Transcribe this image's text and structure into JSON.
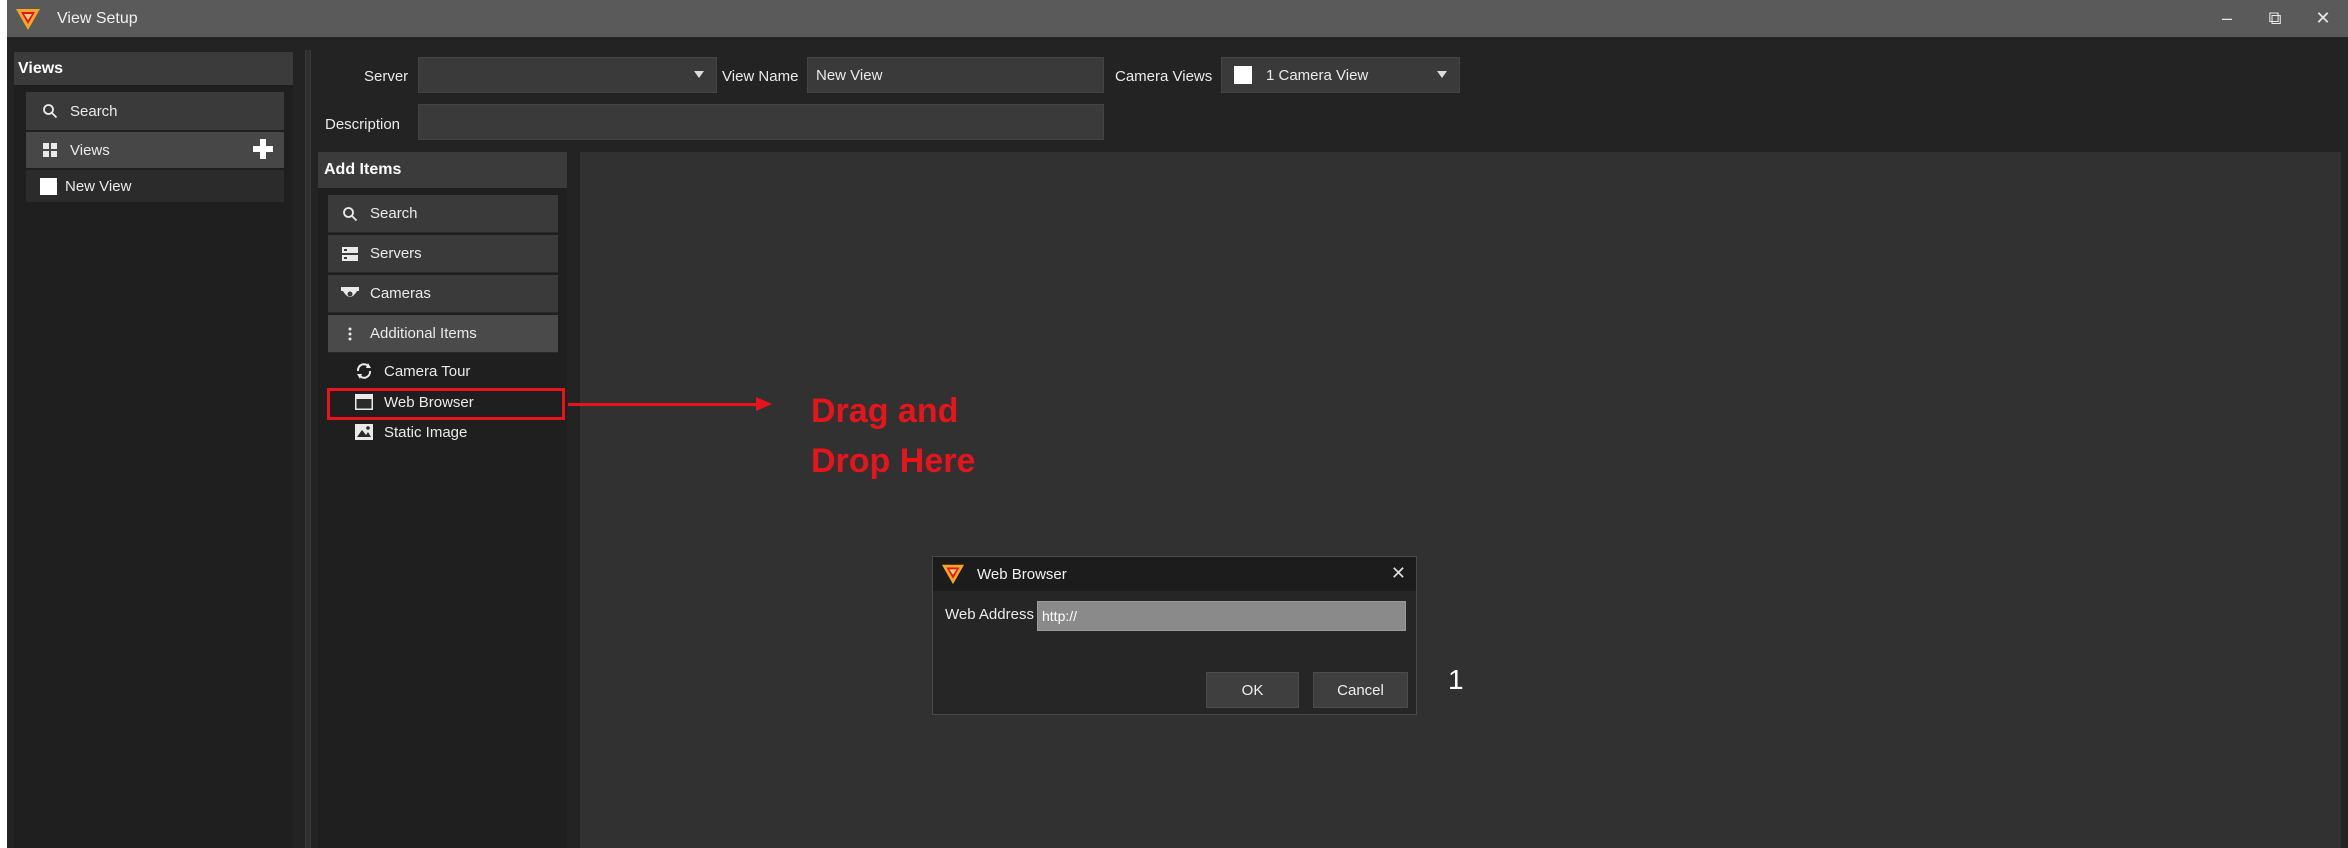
{
  "window": {
    "title": "View Setup",
    "minimize": "–",
    "restore": "⧉",
    "close": "✕"
  },
  "views_panel": {
    "header": "Views",
    "search_label": "Search",
    "views_label": "Views",
    "items": [
      "New View"
    ]
  },
  "form": {
    "server_label": "Server",
    "server_value": "",
    "view_name_label": "View Name",
    "view_name_value": "New View",
    "camera_views_label": "Camera Views",
    "camera_views_value": "1 Camera View",
    "description_label": "Description",
    "description_value": ""
  },
  "add_items": {
    "header": "Add Items",
    "search": "Search",
    "servers": "Servers",
    "cameras": "Cameras",
    "additional": "Additional Items",
    "sub_items": [
      "Camera Tour",
      "Web Browser",
      "Static Image"
    ]
  },
  "annotation": {
    "drag_line1": "Drag and",
    "drag_line2": "Drop Here",
    "step": "1",
    "color": "#e8141c"
  },
  "dialog": {
    "title": "Web Browser",
    "close": "✕",
    "web_address_label": "Web Address",
    "web_address_value": "http://",
    "ok": "OK",
    "cancel": "Cancel"
  },
  "colors": {
    "logo_orange": "#f5a623",
    "logo_red": "#e8141c"
  }
}
